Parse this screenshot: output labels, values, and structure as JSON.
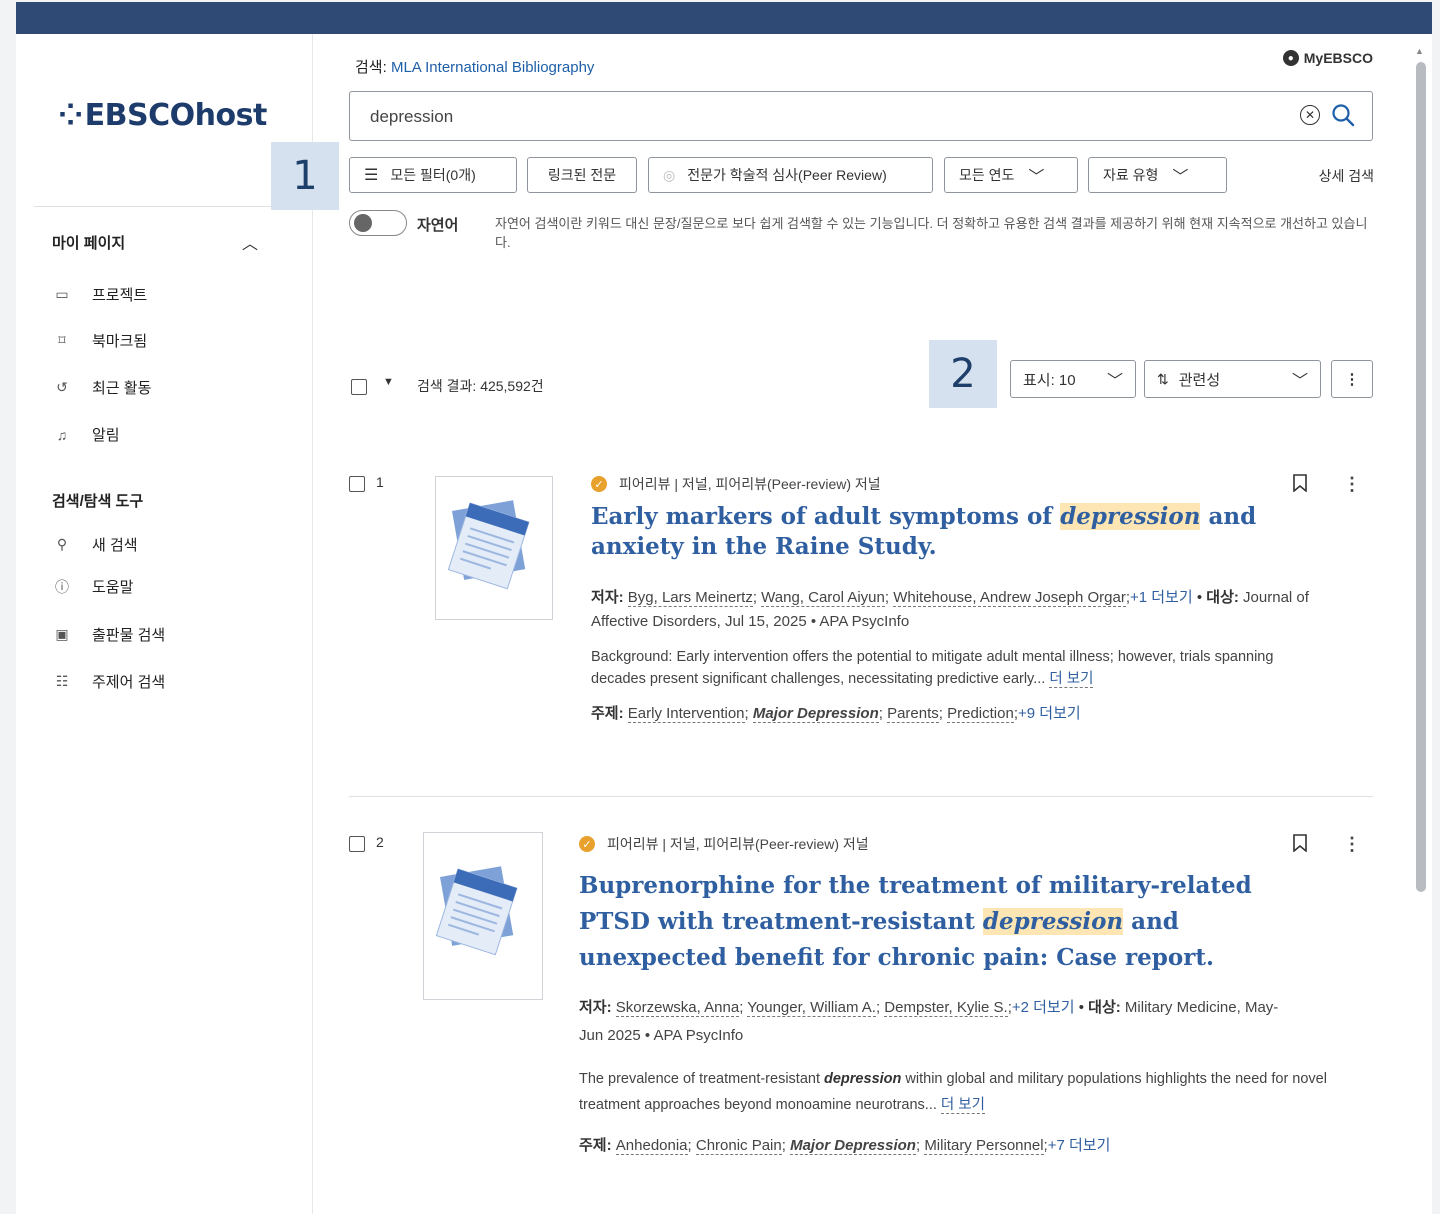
{
  "sidebar": {
    "logo": "EBSCOhost",
    "section_my": "마이 페이지",
    "my_items": [
      {
        "label": "프로젝트",
        "icon": "folder-icon"
      },
      {
        "label": "북마크됨",
        "icon": "bookmark-icon"
      },
      {
        "label": "최근 활동",
        "icon": "history-icon"
      },
      {
        "label": "알림",
        "icon": "bell-icon"
      }
    ],
    "section_tools": "검색/탐색 도구",
    "tool_items": [
      {
        "label": "새 검색",
        "icon": "search-icon"
      },
      {
        "label": "도움말",
        "icon": "help-icon"
      },
      {
        "label": "출판물 검색",
        "icon": "publication-icon"
      },
      {
        "label": "주제어 검색",
        "icon": "subject-tree-icon"
      }
    ]
  },
  "header": {
    "db_prefix": "검색:",
    "database": "MLA International Bibliography",
    "account": "MyEBSCO"
  },
  "search": {
    "value": "depression"
  },
  "filters": {
    "all_filters": "모든 필터(0개)",
    "linked_full_text": "링크된 전문",
    "peer_review": "전문가 학술적 심사(Peer Review)",
    "all_years": "모든 연도",
    "source_type": "자료 유형",
    "advanced": "상세 검색"
  },
  "badges": {
    "one": "1",
    "two": "2"
  },
  "natural_language": {
    "label": "자연어",
    "description": "자연어 검색이란 키워드 대신 문장/질문으로 보다 쉽게 검색할 수 있는 기능입니다. 더 정확하고 유용한 검색 결과를 제공하기 위해 현재 지속적으로 개선하고 있습니다."
  },
  "results_bar": {
    "count": "검색 결과: 425,592건",
    "per_page": "표시: 10",
    "sort": "관련성"
  },
  "results": [
    {
      "num": "1",
      "type": "피어리뷰 | 저널, 피어리뷰(Peer-review) 저널",
      "title_pre": "Early markers of adult symptoms of ",
      "title_hl": "depression",
      "title_post": " and anxiety in the Raine Study.",
      "authors_label": "저자:",
      "authors": [
        "Byg, Lars Meinertz",
        "Wang, Carol Aiyun",
        "Whitehouse, Andrew Joseph Orgar"
      ],
      "authors_more": "+1 더보기",
      "source_label": "대상:",
      "source": "Journal of Affective Disorders, Jul 15, 2025 • APA PsycInfo",
      "abstract": "Background: Early intervention offers the potential to mitigate adult mental illness; however, trials spanning decades present significant challenges, necessitating predictive early...",
      "abstract_more": "더 보기",
      "subjects_label": "주제:",
      "subjects": [
        "Early Intervention",
        "Major Depression",
        "Parents",
        "Prediction"
      ],
      "subjects_more": "+9 더보기"
    },
    {
      "num": "2",
      "type": "피어리뷰 | 저널, 피어리뷰(Peer-review) 저널",
      "title_pre": "Buprenorphine for the treatment of military-related PTSD with treatment-resistant ",
      "title_hl": "depression",
      "title_post": " and unexpected benefit for chronic pain: Case report.",
      "authors_label": "저자:",
      "authors": [
        "Skorzewska, Anna",
        "Younger, William A.",
        "Dempster, Kylie S."
      ],
      "authors_more": "+2 더보기",
      "source_label": "대상:",
      "source": "Military Medicine, May-Jun 2025 • APA PsycInfo",
      "abstract_pre": "The prevalence of treatment-resistant ",
      "abstract_hl": "depression",
      "abstract_post": " within global and military populations highlights the need for novel treatment approaches beyond monoamine neurotrans...",
      "abstract_more": "더 보기",
      "subjects_label": "주제:",
      "subjects": [
        "Anhedonia",
        "Chronic Pain",
        "Major Depression",
        "Military Personnel"
      ],
      "subjects_more": "+7 더보기"
    }
  ],
  "colors": {
    "topbar": "#2e4a75",
    "link": "#2f5fa0",
    "highlight": "#fde6b3",
    "badge": "#d5e1ee"
  }
}
